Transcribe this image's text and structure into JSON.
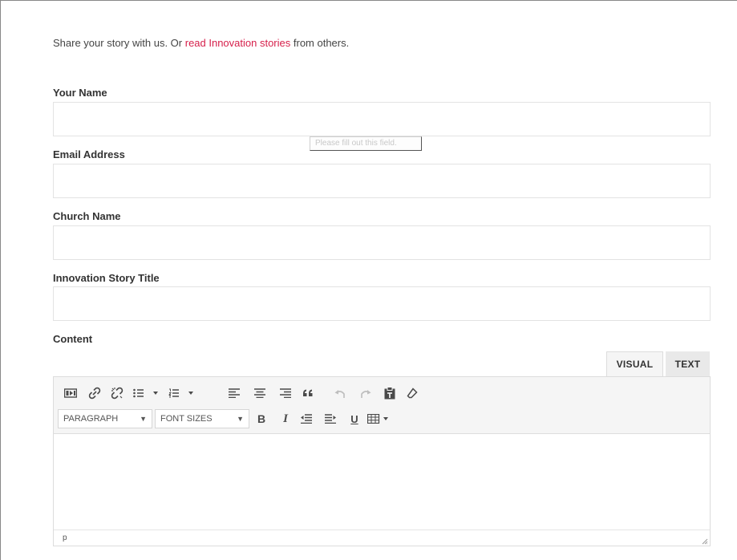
{
  "intro": {
    "prefix": "Share your story with us. Or ",
    "link": "read Innovation stories",
    "suffix": " from others."
  },
  "form": {
    "name_label": "Your Name",
    "name_value": "",
    "email_label": "Email Address",
    "email_value": "",
    "church_label": "Church Name",
    "church_value": "",
    "title_label": "Innovation Story Title",
    "title_value": "",
    "content_label": "Content"
  },
  "tooltip": {
    "text": "Please fill out this field."
  },
  "editor": {
    "tabs": {
      "visual": "VISUAL",
      "text": "TEXT"
    },
    "active_tab": "VISUAL",
    "toolbar_row1": [
      "insert-media-icon",
      "link-icon",
      "unlink-icon",
      "bullet-list-icon",
      "numbered-list-icon",
      "align-left-icon",
      "align-center-icon",
      "align-right-icon",
      "blockquote-icon",
      "undo-icon",
      "redo-icon",
      "paste-text-icon",
      "clear-formatting-icon"
    ],
    "toolbar_row2": [
      "bold-icon",
      "italic-icon",
      "outdent-icon",
      "indent-icon",
      "underline-icon",
      "table-icon"
    ],
    "format_select": "PARAGRAPH",
    "font_size_select": "FONT SIZES",
    "bold_glyph": "B",
    "italic_glyph": "I",
    "underline_glyph": "U",
    "status_path": "p"
  },
  "colors": {
    "link": "#d6204b",
    "border": "#e3e3e3",
    "toolbar_bg": "#f5f5f5"
  }
}
